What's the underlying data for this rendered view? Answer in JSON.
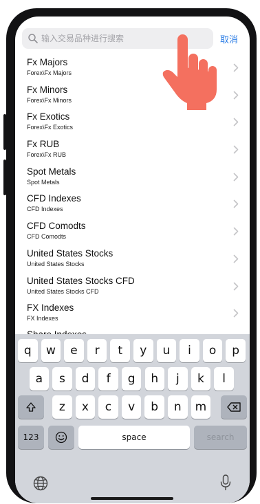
{
  "search": {
    "placeholder": "输入交易品种进行搜索",
    "cancel_label": "取消"
  },
  "instruments": [
    {
      "name": "Fx Majors",
      "path": "Forex\\Fx Majors"
    },
    {
      "name": "Fx Minors",
      "path": "Forex\\Fx Minors"
    },
    {
      "name": "Fx Exotics",
      "path": "Forex\\Fx Exotics"
    },
    {
      "name": "Fx RUB",
      "path": "Forex\\Fx RUB"
    },
    {
      "name": "Spot Metals",
      "path": "Spot Metals"
    },
    {
      "name": "CFD Indexes",
      "path": "CFD Indexes"
    },
    {
      "name": "CFD Comodts",
      "path": "CFD Comodts"
    },
    {
      "name": "United States Stocks",
      "path": "United States Stocks"
    },
    {
      "name": "United States Stocks CFD",
      "path": "United States Stocks CFD"
    },
    {
      "name": "FX Indexes",
      "path": "FX Indexes"
    }
  ],
  "partial_item": "Share Indexes",
  "keyboard": {
    "row1": [
      "q",
      "w",
      "e",
      "r",
      "t",
      "y",
      "u",
      "i",
      "o",
      "p"
    ],
    "row2": [
      "a",
      "s",
      "d",
      "f",
      "g",
      "h",
      "j",
      "k",
      "l"
    ],
    "row3": [
      "z",
      "x",
      "c",
      "v",
      "b",
      "n",
      "m"
    ],
    "numbers_label": "123",
    "space_label": "space",
    "search_label": "search"
  },
  "colors": {
    "accent": "#2f7fe6",
    "hand": "#f4705f"
  }
}
